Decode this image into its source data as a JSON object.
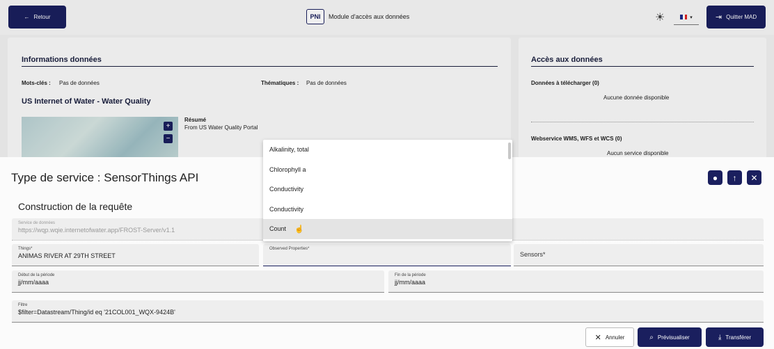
{
  "header": {
    "back_label": "Retour",
    "logo_text": "PNI",
    "title": "Module d'accès aux données",
    "quit_label": "Quitter MAD",
    "theme_icon": "sun-icon",
    "lang_icon": "french-flag-icon"
  },
  "info_card": {
    "title": "Informations données",
    "keywords_label": "Mots-clés :",
    "keywords_value": "Pas de données",
    "themes_label": "Thématiques :",
    "themes_value": "Pas de données",
    "dataset_title": "US Internet of Water - Water Quality",
    "summary_label": "Résumé",
    "summary_value": "From US Water Quality Portal",
    "zoom_in": "+",
    "zoom_out": "−"
  },
  "access_card": {
    "title": "Accès aux données",
    "downloads_label": "Données à télécharger (0)",
    "downloads_empty": "Aucune donnée disponible",
    "webservices_label": "Webservice WMS, WFS et WCS (0)",
    "webservices_empty": "Aucun service disponible"
  },
  "sheet": {
    "title": "Type de service : SensorThings API",
    "subtitle": "Construction de la requête",
    "service": {
      "label": "Service de données",
      "value": "https://wqp.wqie.internetofwater.app/FROST-Server/v1.1"
    },
    "things": {
      "label": "Things*",
      "value": "ANIMAS RIVER AT 29TH STREET"
    },
    "observed": {
      "label": "Observed Properties*",
      "value": ""
    },
    "sensors": {
      "placeholder": "Sensors*"
    },
    "start": {
      "label": "Début de la période",
      "value": "jj/mm/aaaa"
    },
    "end": {
      "label": "Fin de la période",
      "value": "jj/mm/aaaa"
    },
    "filter": {
      "label": "Filtre",
      "value": "$filter=Datastream/Thing/id eq '21COL001_WQX-9424B'"
    },
    "cancel_label": "Annuler",
    "preview_label": "Prévisualiser",
    "transfer_label": "Transférer"
  },
  "dropdown": {
    "options": [
      "Alkalinity, total",
      "Chlorophyll a",
      "Conductivity",
      "Conductivity",
      "Count"
    ],
    "hovered_index": 4
  },
  "colors": {
    "primary": "#1a1f5e",
    "field_bg": "#eeeeee"
  }
}
